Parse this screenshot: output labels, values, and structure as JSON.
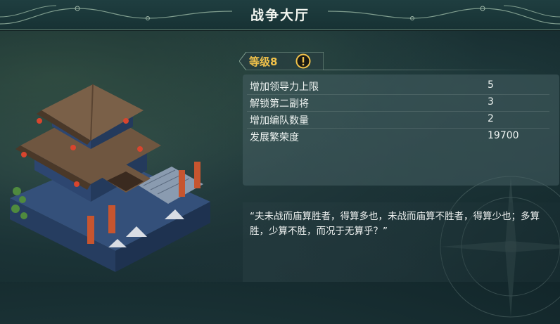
{
  "window": {
    "title": "战争大厅"
  },
  "level": {
    "label": "等级8",
    "icon": "warning-icon"
  },
  "stats": [
    {
      "label": "增加领导力上限",
      "value": "5"
    },
    {
      "label": "解锁第二副将",
      "value": "3"
    },
    {
      "label": "增加编队数量",
      "value": "2"
    },
    {
      "label": "发展繁荣度",
      "value": "19700"
    }
  ],
  "quote": "“夫未战而庙算胜者，得算多也，未战而庙算不胜者，得算少也；多算胜，少算不胜，而况于无算乎？”",
  "colors": {
    "level_accent": "#f2c24a",
    "title_bar": "#1f3e40",
    "panel": "#46605f"
  }
}
